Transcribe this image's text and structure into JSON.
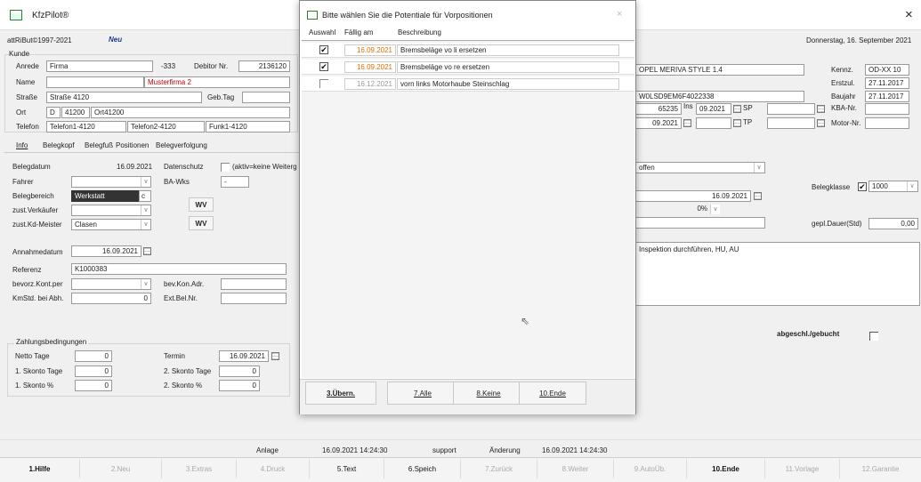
{
  "app": {
    "title": "KfzPilot®",
    "close": "×",
    "copyright": "attRiBut©1997-2021",
    "neu": "Neu",
    "date": "Donnerstag, 16. September 2021"
  },
  "kunde": {
    "title": "Kunde",
    "anrede_label": "Anrede",
    "anrede": "Firma",
    "num": "-333",
    "debitor_label": "Debitor Nr.",
    "debitor": "2136120",
    "name_label": "Name",
    "name": "Musterfirma 2",
    "strasse_label": "Straße",
    "strasse": "Straße 4120",
    "gebtag_label": "Geb.Tag",
    "ort_label": "Ort",
    "land": "D",
    "plz": "41200",
    "ort": "Ort41200",
    "telefon_label": "Telefon",
    "telefon1": "Telefon1-4120",
    "telefon2": "Telefon2-4120",
    "funk": "Funk1-4120"
  },
  "tabs": [
    "Info",
    "Belegkopf",
    "Belegfuß",
    "Positionen",
    "Belegverfolgung"
  ],
  "info": {
    "belegdatum_label": "Belegdatum",
    "belegdatum": "16.09.2021",
    "datenschutz_label": "Datenschutz",
    "datenschutz_note": "(aktiv=keine Weiterg",
    "fahrer_label": "Fahrer",
    "bawks_label": "BA-Wks",
    "bawks": "-",
    "belegbereich_label": "Belegbereich",
    "belegbereich": "Werkstatt",
    "belegbereich_mark": "c",
    "verkaeufer_label": "zust.Verkäufer",
    "kdmeister_label": "zust.Kd-Meister",
    "kdmeister": "Clasen",
    "wv": "WV",
    "annahme_label": "Annahmedatum",
    "annahme": "16.09.2021",
    "referenz_label": "Referenz",
    "referenz": "K1000383",
    "kontper_label": "bevorz.Kont.per",
    "konadr_label": "bev.Kon.Adr.",
    "kmstd_label": "KmStd. bei Abh.",
    "kmstd": "0",
    "extbel_label": "Ext.Bel.Nr."
  },
  "zahlung": {
    "title": "Zahlungsbedingungen",
    "netto_label": "Netto Tage",
    "netto": "0",
    "termin_label": "Termin",
    "termin": "16.09.2021",
    "skonto1t_label": "1. Skonto Tage",
    "skonto1t": "0",
    "skonto2t_label": "2. Skonto Tage",
    "skonto2t": "0",
    "skonto1p_label": "1. Skonto %",
    "skonto1p": "0",
    "skonto2p_label": "2. Skonto %",
    "skonto2p": "0"
  },
  "fahrzeug": {
    "modell": "OPEL MERIVA STYLE 1.4",
    "vin": "W0LSD9EM6F4022338",
    "km": "65235",
    "ins_label": "Ins",
    "ins": "09.2021",
    "sp_label": "SP",
    "tp_label": "TP",
    "tuv": "09.2021",
    "kennz_label": "Kennz.",
    "kennz": "OD-XX 10",
    "erstzul_label": "Erstzul.",
    "erstzul": "27.11.2017",
    "baujahr_label": "Baujahr",
    "baujahr": "27.11.2017",
    "kba_label": "KBA-Nr.",
    "motor_label": "Motor-Nr."
  },
  "right": {
    "status": "offen",
    "belegklasse_label": "Belegklasse",
    "belegklasse": "1000",
    "datum": "16.09.2021",
    "prozent": "0%",
    "dauer_label": "gepl.Dauer(Std)",
    "dauer": "0,00",
    "text": "Inspektion durchführen, HU, AU",
    "abgeschl_label": "abgeschl./gebucht"
  },
  "status_bar": {
    "anlage_label": "Anlage",
    "anlage": "16.09.2021 14:24:30",
    "user": "support",
    "aenderung_label": "Änderung",
    "aenderung": "16.09.2021 14:24:30"
  },
  "footer": [
    "1.Hilfe",
    "2.Neu",
    "3.Extras",
    "4.Druck",
    "5.Text",
    "6.Speich",
    "7.Zurück",
    "8.Weiter",
    "9.AutoÜb.",
    "10.Ende",
    "11.Vorlage",
    "12.Garantie"
  ],
  "dialog": {
    "title": "Bitte wählen Sie die Potentiale für Vorpositionen",
    "col_auswahl": "Auswahl",
    "col_faellig": "Fällig am",
    "col_beschreibung": "Beschreibung",
    "rows": [
      {
        "checked": true,
        "date": "16.09.2021",
        "desc": "Bremsbeläge vo li ersetzen"
      },
      {
        "checked": true,
        "date": "16.09.2021",
        "desc": "Bremsbeläge vo re ersetzen"
      },
      {
        "checked": false,
        "date": "16.12.2021",
        "desc": "vorn links Motorhaube Steinschlag"
      }
    ],
    "btn_uebern": "3.Übern.",
    "btn_alle": "7.Alle",
    "btn_keine": "8.Keine",
    "btn_ende": "10.Ende"
  },
  "colors": {
    "red": "#c00000",
    "orange": "#e07000",
    "blue": "#1a3a8a"
  }
}
